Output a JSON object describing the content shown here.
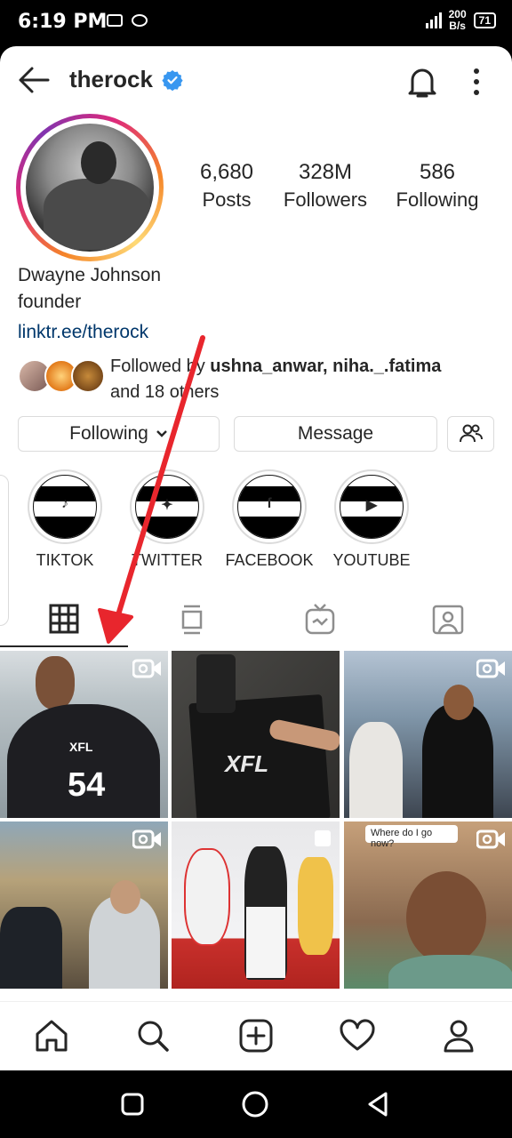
{
  "status_bar": {
    "time": "6:19 PM",
    "network_speed": "200",
    "network_unit": "B/s",
    "battery": "71"
  },
  "header": {
    "username": "therock"
  },
  "profile": {
    "stats": [
      {
        "value": "6,680",
        "label": "Posts"
      },
      {
        "value": "328M",
        "label": "Followers"
      },
      {
        "value": "586",
        "label": "Following"
      }
    ],
    "name": "Dwayne Johnson",
    "category": "founder",
    "link": "linktr.ee/therock",
    "followed_by_prefix": "Followed by ",
    "followed_by_users": "ushna_anwar, niha._.fatima",
    "followed_by_suffix": "and 18 others"
  },
  "actions": {
    "following_label": "Following",
    "message_label": "Message"
  },
  "highlights": [
    {
      "label": "TIKTOK",
      "icon": "tiktok-icon"
    },
    {
      "label": "TWITTER",
      "icon": "twitter-icon"
    },
    {
      "label": "FACEBOOK",
      "icon": "facebook-icon"
    },
    {
      "label": "YOUTUBE",
      "icon": "youtube-icon"
    }
  ],
  "tabs": [
    "grid-icon",
    "feed-icon",
    "igtv-icon",
    "tagged-icon"
  ],
  "grid_overlay_text": {
    "post_6": "Where do I go now?",
    "post_1_jersey": "54",
    "post_1_logo": "XFL",
    "post_2_logo": "XFL"
  },
  "colors": {
    "link": "#00376b",
    "verified": "#3897f0",
    "annotation_arrow": "#e8262d"
  }
}
